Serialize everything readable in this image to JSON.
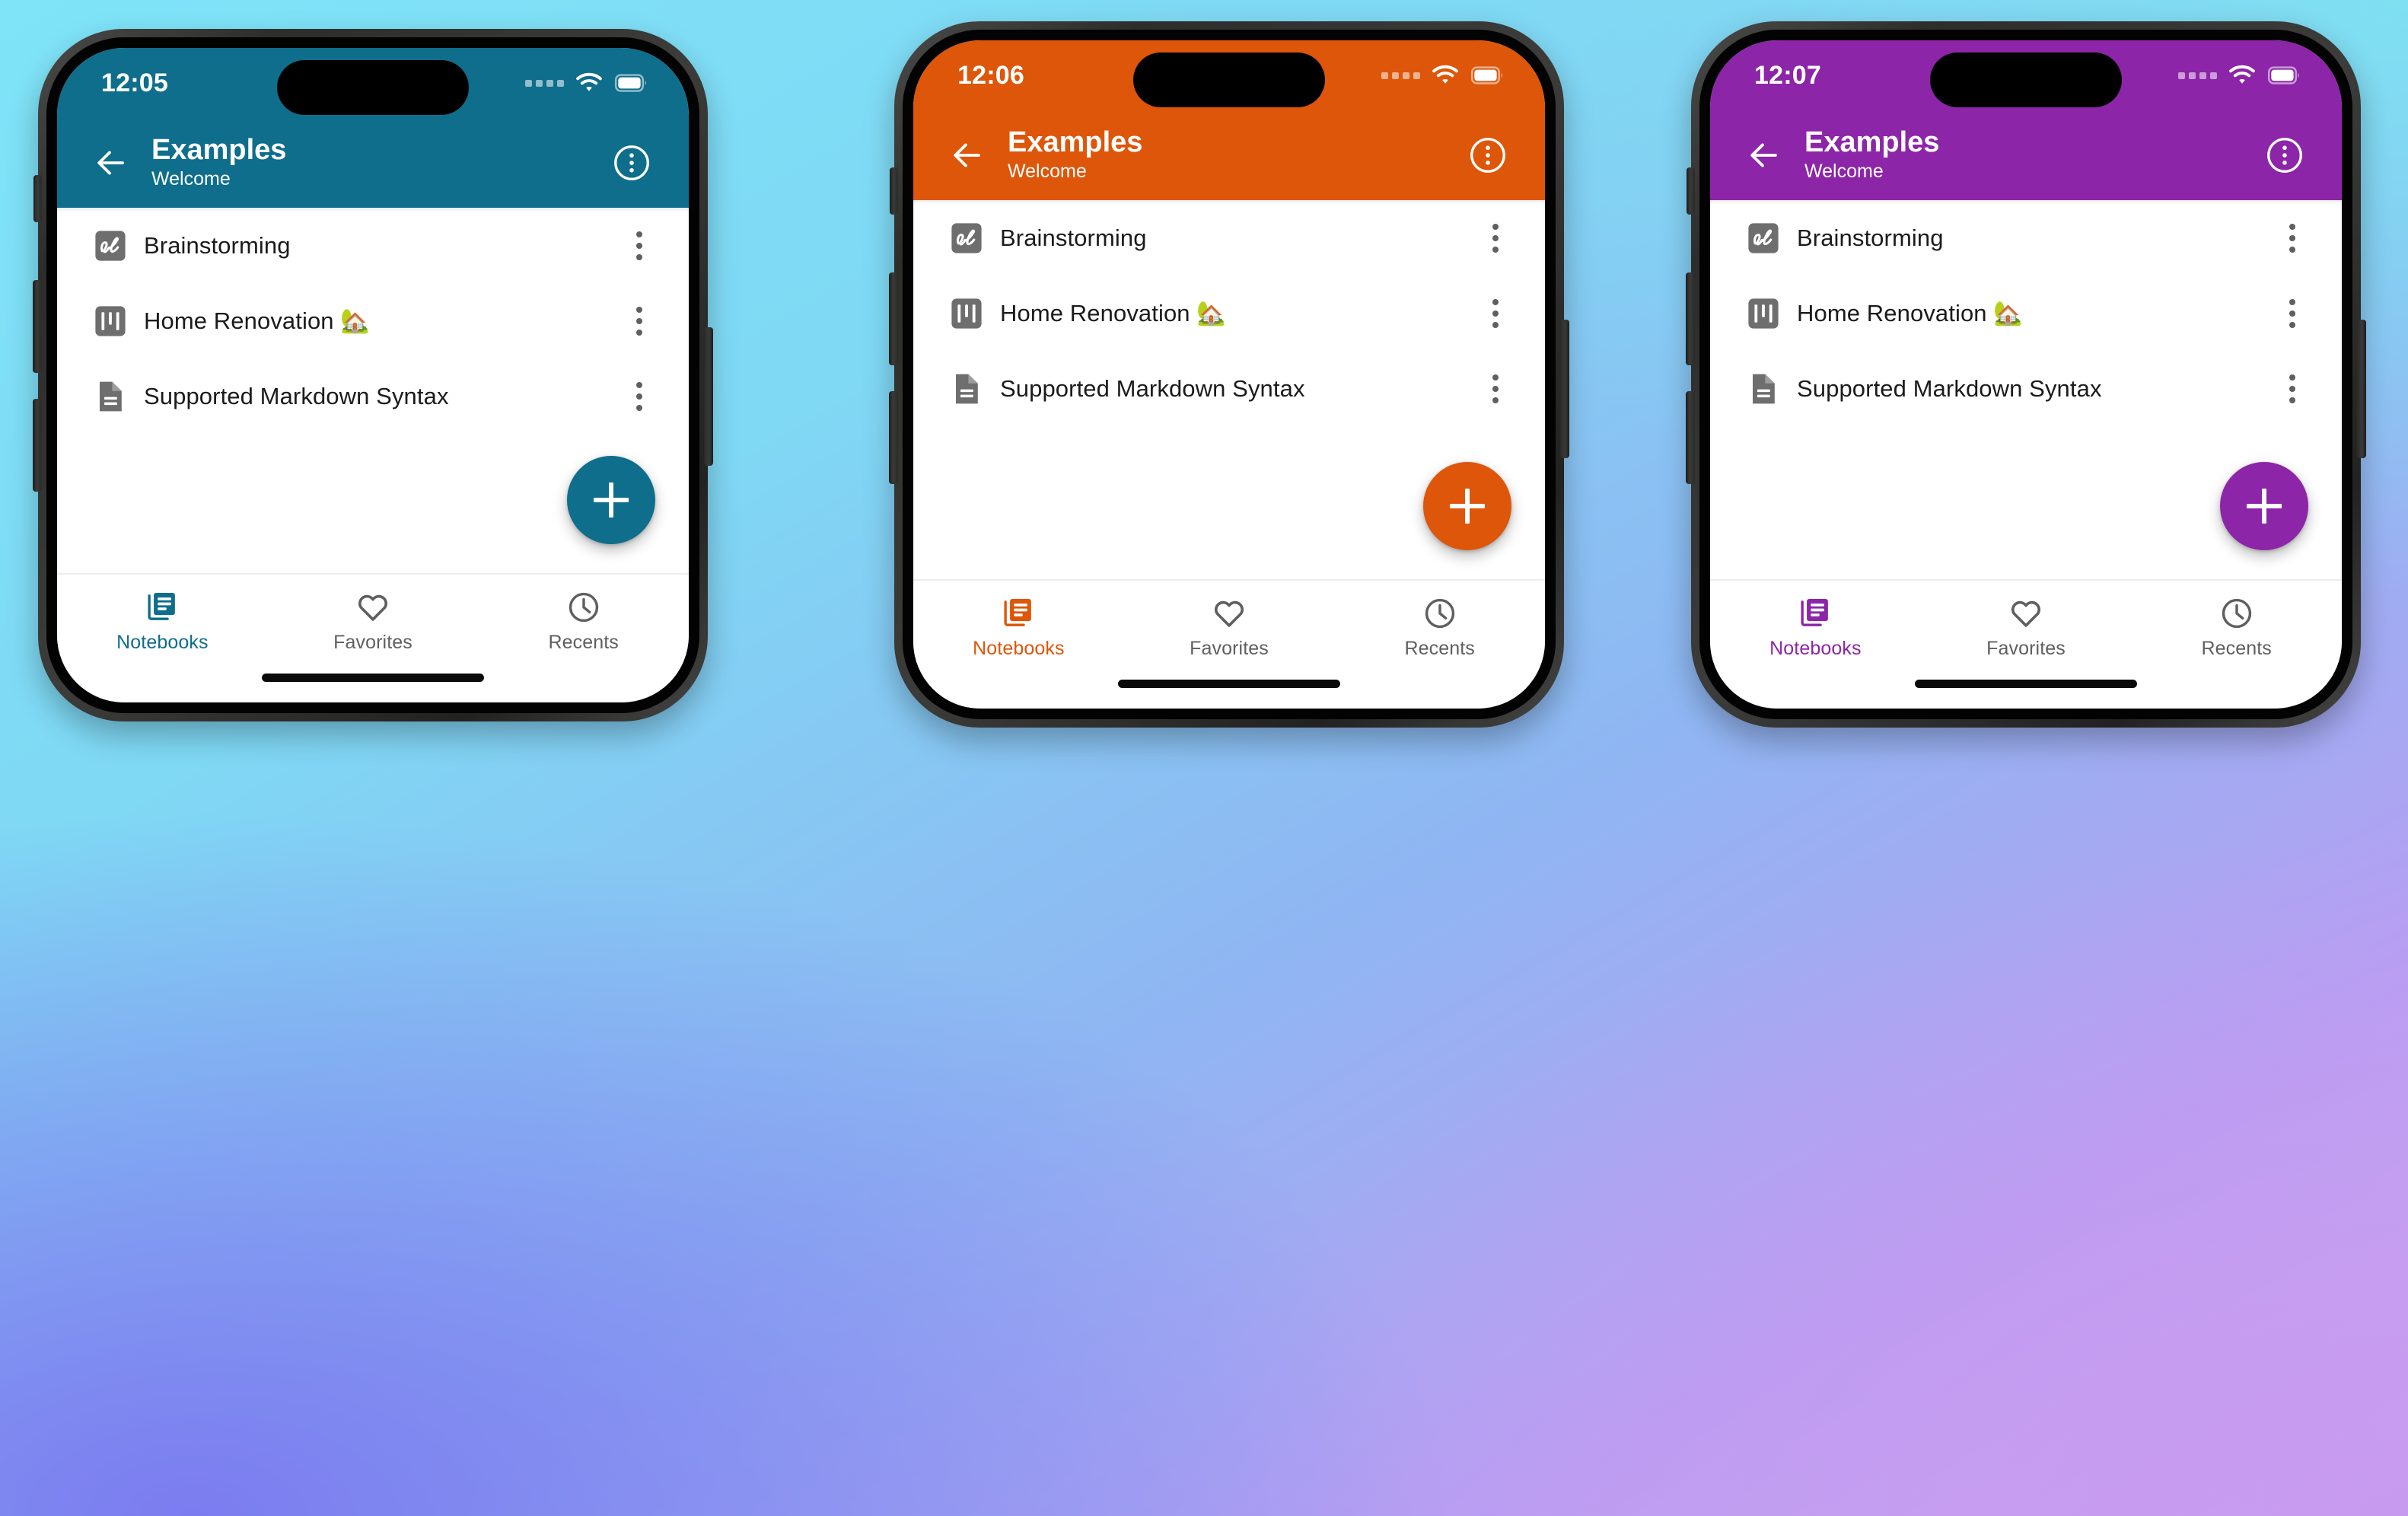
{
  "app": {
    "title": "Examples",
    "subtitle": "Welcome",
    "back_icon": "arrow-left-icon",
    "overflow_icon": "more-vertical-circle-icon",
    "fab_label": "+",
    "fab_icon": "plus-icon"
  },
  "notes": [
    {
      "icon": "whiteboard-icon",
      "label": "Brainstorming",
      "emoji": "",
      "more_icon": "more-vertical-icon"
    },
    {
      "icon": "kanban-board-icon",
      "label": "Home Renovation",
      "emoji": "🏡",
      "more_icon": "more-vertical-icon"
    },
    {
      "icon": "document-icon",
      "label": "Supported Markdown Syntax",
      "emoji": "",
      "more_icon": "more-vertical-icon"
    }
  ],
  "bottom_nav": [
    {
      "label": "Notebooks",
      "icon": "notebooks-icon",
      "active": true
    },
    {
      "label": "Favorites",
      "icon": "heart-icon",
      "active": false
    },
    {
      "label": "Recents",
      "icon": "clock-icon",
      "active": false
    }
  ],
  "status_bar": {
    "signal_icon": "cellular-signal-icon",
    "wifi_icon": "wifi-icon",
    "battery_icon": "battery-full-icon"
  },
  "phones": [
    {
      "id": "phone-teal",
      "time": "12:05",
      "accent": "#0e6e8c",
      "accent_name": "teal",
      "nav_active_color": "#0e6e8c",
      "nav_inactive_color": "#5f5f5f"
    },
    {
      "id": "phone-orange",
      "time": "12:06",
      "accent": "#de5609",
      "accent_name": "orange",
      "nav_active_color": "#de5609",
      "nav_inactive_color": "#5f5f5f"
    },
    {
      "id": "phone-purple",
      "time": "12:07",
      "accent": "#8c25a8",
      "accent_name": "purple",
      "nav_active_color": "#8c25a8",
      "nav_inactive_color": "#5f5f5f"
    }
  ],
  "background": {
    "colors": [
      "#7fe4f8",
      "#8fb6f2",
      "#7b7cf0",
      "#c79af0"
    ]
  }
}
